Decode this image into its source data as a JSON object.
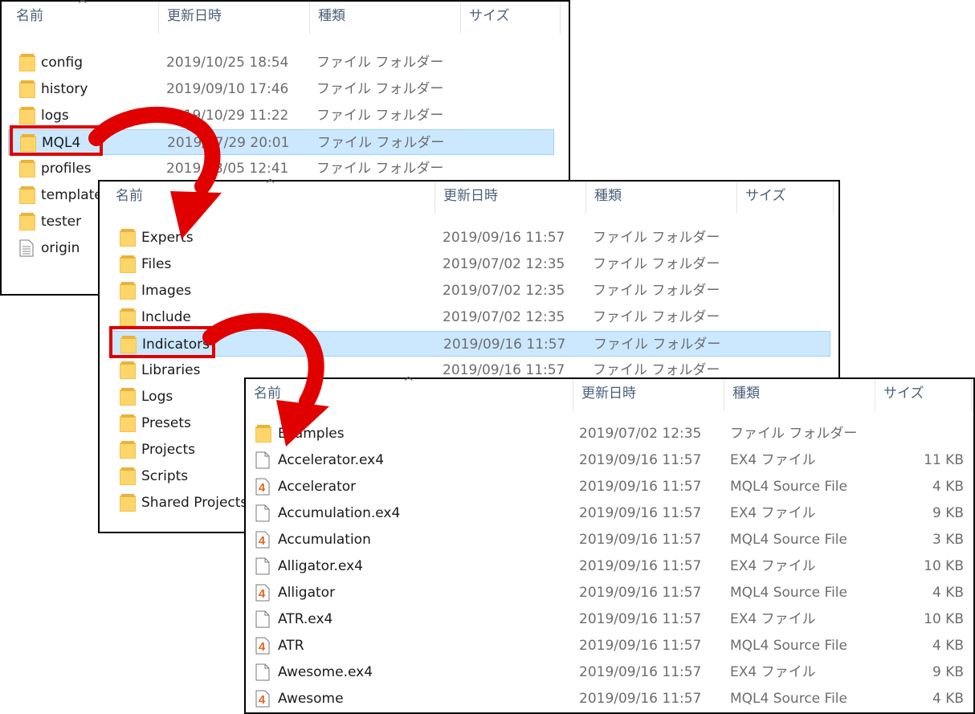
{
  "headers": {
    "name": "名前",
    "date": "更新日時",
    "type": "種類",
    "size": "サイズ",
    "sort_indicator": "^"
  },
  "panel1": {
    "rows": [
      {
        "name": "config",
        "date": "2019/10/25 18:54",
        "type": "ファイル フォルダー",
        "icon": "folder-icon"
      },
      {
        "name": "history",
        "date": "2019/09/10 17:46",
        "type": "ファイル フォルダー",
        "icon": "folder-icon"
      },
      {
        "name": "logs",
        "date": "2019/10/29 11:22",
        "type": "ファイル フォルダー",
        "icon": "folder-icon"
      },
      {
        "name": "MQL4",
        "date": "2019/07/29 20:01",
        "type": "ファイル フォルダー",
        "icon": "folder-icon",
        "selected": true
      },
      {
        "name": "profiles",
        "date": "2019/08/05 12:41",
        "type": "ファイル フォルダー",
        "icon": "folder-icon"
      },
      {
        "name": "templates",
        "date": "",
        "type": "",
        "icon": "folder-icon"
      },
      {
        "name": "tester",
        "date": "",
        "type": "",
        "icon": "folder-icon"
      },
      {
        "name": "origin",
        "date": "",
        "type": "",
        "icon": "text-file-icon"
      }
    ]
  },
  "panel2": {
    "rows": [
      {
        "name": "Experts",
        "date": "2019/09/16 11:57",
        "type": "ファイル フォルダー",
        "icon": "folder-icon"
      },
      {
        "name": "Files",
        "date": "2019/07/02 12:35",
        "type": "ファイル フォルダー",
        "icon": "folder-icon"
      },
      {
        "name": "Images",
        "date": "2019/07/02 12:35",
        "type": "ファイル フォルダー",
        "icon": "folder-icon"
      },
      {
        "name": "Include",
        "date": "2019/07/02 12:35",
        "type": "ファイル フォルダー",
        "icon": "folder-icon"
      },
      {
        "name": "Indicators",
        "date": "2019/09/16 11:57",
        "type": "ファイル フォルダー",
        "icon": "folder-icon",
        "selected": true
      },
      {
        "name": "Libraries",
        "date": "2019/09/16 11:57",
        "type": "ファイル フォルダー",
        "icon": "folder-icon"
      },
      {
        "name": "Logs",
        "date": "",
        "type": "",
        "icon": "folder-icon"
      },
      {
        "name": "Presets",
        "date": "",
        "type": "",
        "icon": "folder-icon"
      },
      {
        "name": "Projects",
        "date": "",
        "type": "",
        "icon": "folder-icon"
      },
      {
        "name": "Scripts",
        "date": "",
        "type": "",
        "icon": "folder-icon"
      },
      {
        "name": "Shared Projects",
        "date": "",
        "type": "",
        "icon": "folder-icon"
      }
    ]
  },
  "panel3": {
    "rows": [
      {
        "name": "Examples",
        "date": "2019/07/02 12:35",
        "type": "ファイル フォルダー",
        "size": "",
        "icon": "folder-icon"
      },
      {
        "name": "Accelerator.ex4",
        "date": "2019/09/16 11:57",
        "type": "EX4 ファイル",
        "size": "11 KB",
        "icon": "blank-file-icon"
      },
      {
        "name": "Accelerator",
        "date": "2019/09/16 11:57",
        "type": "MQL4 Source File",
        "size": "4 KB",
        "icon": "mql4-file-icon"
      },
      {
        "name": "Accumulation.ex4",
        "date": "2019/09/16 11:57",
        "type": "EX4 ファイル",
        "size": "9 KB",
        "icon": "blank-file-icon"
      },
      {
        "name": "Accumulation",
        "date": "2019/09/16 11:57",
        "type": "MQL4 Source File",
        "size": "3 KB",
        "icon": "mql4-file-icon"
      },
      {
        "name": "Alligator.ex4",
        "date": "2019/09/16 11:57",
        "type": "EX4 ファイル",
        "size": "10 KB",
        "icon": "blank-file-icon"
      },
      {
        "name": "Alligator",
        "date": "2019/09/16 11:57",
        "type": "MQL4 Source File",
        "size": "4 KB",
        "icon": "mql4-file-icon"
      },
      {
        "name": "ATR.ex4",
        "date": "2019/09/16 11:57",
        "type": "EX4 ファイル",
        "size": "10 KB",
        "icon": "blank-file-icon"
      },
      {
        "name": "ATR",
        "date": "2019/09/16 11:57",
        "type": "MQL4 Source File",
        "size": "4 KB",
        "icon": "mql4-file-icon"
      },
      {
        "name": "Awesome.ex4",
        "date": "2019/09/16 11:57",
        "type": "EX4 ファイル",
        "size": "9 KB",
        "icon": "blank-file-icon"
      },
      {
        "name": "Awesome",
        "date": "2019/09/16 11:57",
        "type": "MQL4 Source File",
        "size": "4 KB",
        "icon": "mql4-file-icon"
      }
    ]
  },
  "colors": {
    "highlight": "#e00000",
    "selection": "#cce8ff",
    "folder": "#f6c84c"
  },
  "mql4_badge": "4"
}
